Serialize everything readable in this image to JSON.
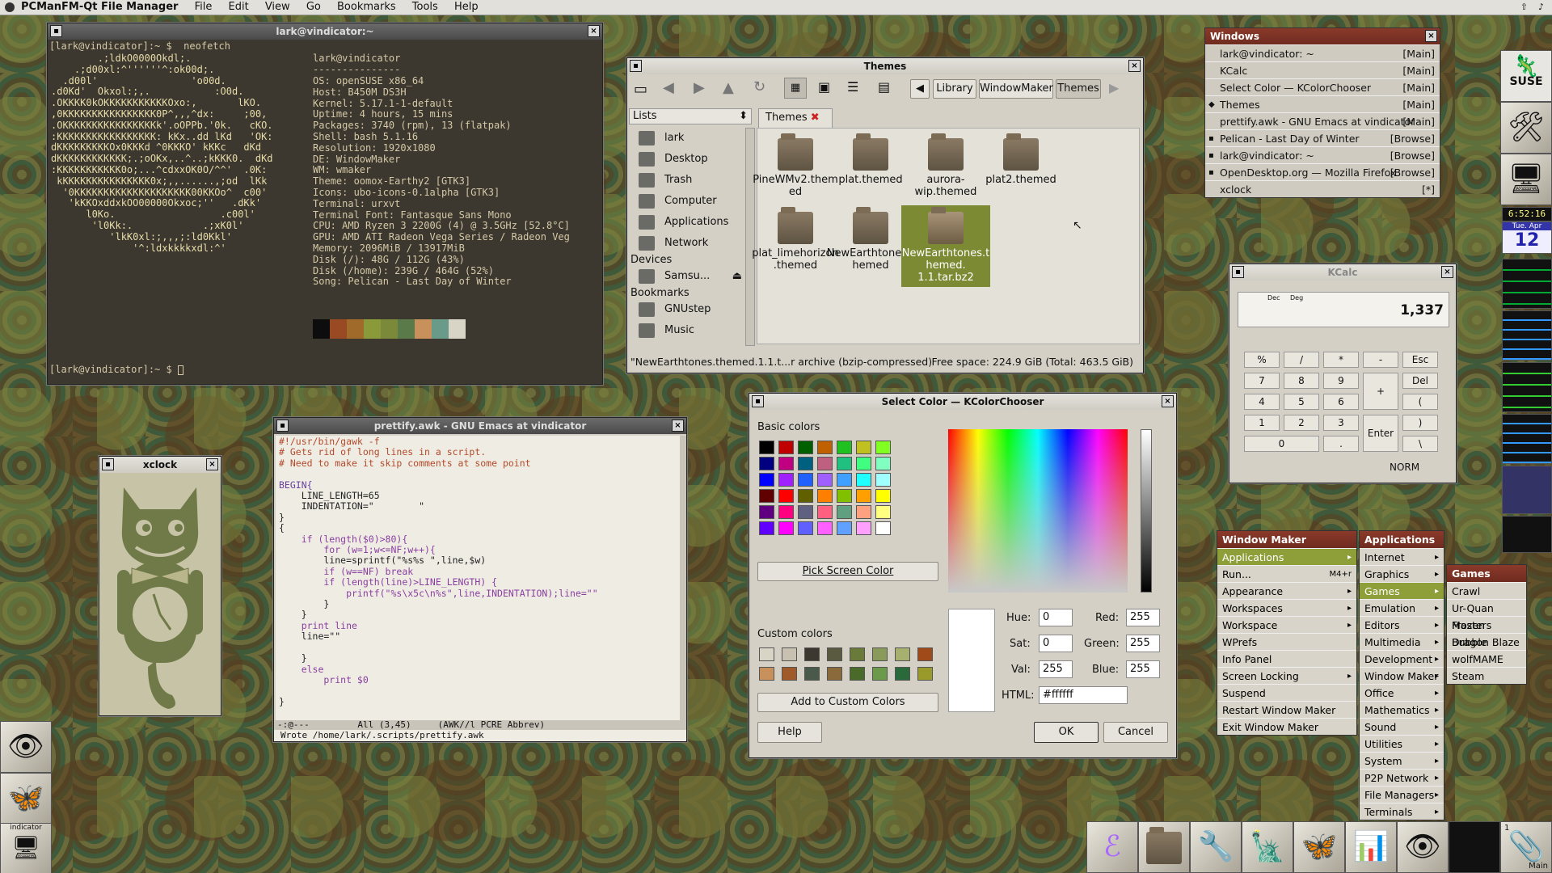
{
  "topbar": {
    "app": "PCManFM-Qt File Manager",
    "menus": [
      "File",
      "Edit",
      "View",
      "Go",
      "Bookmarks",
      "Tools",
      "Help"
    ]
  },
  "terminal": {
    "title": "lark@vindicator:~",
    "prompt": "[lark@vindicator]:~ $  neofetch",
    "logo": [
      "        .;ldkO0000Okdl;.",
      "    .;d00xl:^''''''^:ok00d;.",
      "  .d00l'                'o00d.",
      ".d0Kd'  Okxol:;,.           :O0d.",
      ".OKKKK0kOKKKKKKKKKKKOxo:,       lKO.",
      ",0KKKKKKKKKKKKKKKK0P^,,,^dx:     ;00,",
      ".OKKKKKKKKKKKKKKKKk'.oOPPb.'0k.   cKO.",
      ":KKKKKKKKKKKKKKKKK: kKx..dd lKd   'OK:",
      "dKKKKKKKKKOx0KKKd ^0KKKO' kKKc   dKd",
      "dKKKKKKKKKKKK;.;oOKx,..^..;kKKK0.  dKd",
      ":KKKKKKKKKKK0o;...^cdxxOK0O/^^'  .0K:",
      " kKKKKKKKKKKKKKKK0x;,,......,;od  lKk",
      "  '0KKKKKKKKKKKKKKKKKKKK00KKOo^  c00'",
      "   'kKKOxddxkOO00000Okxoc;''   .dKk'",
      "      l0Ko.                  .c00l'",
      "       'l0Kk:.            .;xK0l'",
      "          'lkK0xl:;,,,;:ld0Kkl'",
      "              '^:ldxkkkkxdl:^'"
    ],
    "user": "lark@vindicator",
    "sep": "---------------",
    "info": [
      "OS: openSUSE x86_64",
      "Host: B450M DS3H",
      "Kernel: 5.17.1-1-default",
      "Uptime: 4 hours, 15 mins",
      "Packages: 3740 (rpm), 13 (flatpak)",
      "Shell: bash 5.1.16",
      "Resolution: 1920x1080",
      "DE: WindowMaker",
      "WM: wmaker",
      "Theme: oomox-Earthy2 [GTK3]",
      "Icons: ubo-icons-0.1alpha [GTK3]",
      "Terminal: urxvt",
      "Terminal Font: Fantasque Sans Mono",
      "CPU: AMD Ryzen 3 2200G (4) @ 3.5GHz [52.8°C]",
      "GPU: AMD ATI Radeon Vega Series / Radeon Veg",
      "Memory: 2096MiB / 13917MiB",
      "Disk (/): 48G / 112G (43%)",
      "Disk (/home): 239G / 464G (52%)",
      "Song: Pelican - Last Day of Winter"
    ],
    "palette": [
      "#0d0d0d",
      "#9a4a22",
      "#a06a2a",
      "#8a9a3a",
      "#7a8a3a",
      "#5a7a4a",
      "#c8905a",
      "#6a9a8a",
      "#d8d4c6"
    ],
    "prompt2": "[lark@vindicator]:~ $ "
  },
  "themes": {
    "title": "Themes",
    "path": [
      "Library",
      "WindowMaker",
      "Themes"
    ],
    "panel_select": "Lists",
    "places": [
      "lark",
      "Desktop",
      "Trash",
      "Computer",
      "Applications",
      "Network"
    ],
    "devices_label": "Devices",
    "devices": [
      "Samsu..."
    ],
    "bookmarks_label": "Bookmarks",
    "bookmarks": [
      "GNUstep",
      "Music"
    ],
    "tab": "Themes",
    "files": [
      "PineWMv2.themed",
      "plat.themed",
      "aurora-wip.themed",
      "plat2.themed",
      "plat_limehorizon.themed",
      "NewEarthtones.themed",
      "NewEarthtones.themed.1.1.tar.bz2"
    ],
    "files_display": [
      "PineWMv2.them\ned",
      "plat.themed",
      "aurora-\nwip.themed",
      "plat2.themed",
      "plat_limehorizon\n.themed",
      "NewEarthtones.t\nhemed",
      "NewEarthtones.t\nhemed.\n1.1.tar.bz2"
    ],
    "status_left": "\"NewEarthtones.themed.1.1.t...r archive (bzip-compressed)",
    "status_right": "Free space: 224.9 GiB (Total: 463.5 GiB)"
  },
  "windows_list": {
    "title": "Windows",
    "rows": [
      {
        "name": "lark@vindicator: ~",
        "tag": "[Main]",
        "mark": ""
      },
      {
        "name": "KCalc",
        "tag": "[Main]",
        "mark": ""
      },
      {
        "name": "Select Color — KColorChooser",
        "tag": "[Main]",
        "mark": ""
      },
      {
        "name": "Themes",
        "tag": "[Main]",
        "mark": "◆"
      },
      {
        "name": "prettify.awk - GNU Emacs at vindicator",
        "tag": "[Main]",
        "mark": ""
      },
      {
        "name": "Pelican - Last Day of Winter",
        "tag": "[Browse]",
        "mark": "▪"
      },
      {
        "name": "lark@vindicator: ~",
        "tag": "[Browse]",
        "mark": "▪"
      },
      {
        "name": "OpenDesktop.org — Mozilla Firefox",
        "tag": "[Browse]",
        "mark": "▪"
      },
      {
        "name": "xclock",
        "tag": "[*]",
        "mark": ""
      }
    ]
  },
  "kcalc": {
    "title": "KCalc",
    "mode1": "Dec",
    "mode2": "Deg",
    "display": "1,337",
    "keys": [
      "%",
      "/",
      "*",
      "-",
      "Esc",
      "7",
      "8",
      "9",
      "+",
      "Del",
      "4",
      "5",
      "6",
      "(",
      "1",
      "2",
      "3",
      "Enter",
      ")",
      "0",
      ".",
      "\\"
    ],
    "status": "NORM"
  },
  "emacs": {
    "title": "prettify.awk - GNU Emacs at vindicator",
    "lines": [
      "#!/usr/bin/gawk -f",
      "# Gets rid of long lines in a script.",
      "# Need to make it skip comments at some point",
      "",
      "BEGIN{",
      "    LINE_LENGTH=65",
      "    INDENTATION=\"        \"",
      "}",
      "{",
      "    if (length($0)>80){",
      "        for (w=1;w<=NF;w++){",
      "        line=sprintf(\"%s%s \",line,$w)",
      "        if (w==NF) break",
      "        if (length(line)>LINE_LENGTH) {",
      "            printf(\"%s\\x5c\\n%s\",line,INDENTATION);line=\"\"",
      "        }",
      "    }",
      "    print line",
      "    line=\"\"",
      "",
      "    }",
      "    else",
      "        print $0",
      "",
      "}"
    ],
    "modeline": "-:@---         All (3,45)     (AWK//l PCRE Abbrev)",
    "echo": "Wrote /home/lark/.scripts/prettify.awk"
  },
  "xclock": {
    "title": "xclock"
  },
  "colorchooser": {
    "title": "Select Color — KColorChooser",
    "basic_label": "Basic colors",
    "basic": [
      "#000000",
      "#c00000",
      "#006000",
      "#c06000",
      "#20c020",
      "#c0c020",
      "#80ff20",
      "#000080",
      "#c00080",
      "#006080",
      "#c06080",
      "#20c080",
      "#40ff80",
      "#80ffc0",
      "#0000ff",
      "#a020ff",
      "#2060ff",
      "#a060ff",
      "#40a0ff",
      "#20ffff",
      "#a0ffff",
      "#600000",
      "#ff0000",
      "#606000",
      "#ff8000",
      "#80c000",
      "#ffa000",
      "#ffff00",
      "#600080",
      "#ff0080",
      "#606080",
      "#ff6080",
      "#60a080",
      "#ffa080",
      "#ffff80",
      "#6000ff",
      "#ff00ff",
      "#6060ff",
      "#ff60ff",
      "#60a0ff",
      "#ffa0ff",
      "#ffffff"
    ],
    "pick_label": "Pick Screen Color",
    "custom_label": "Custom colors",
    "custom": [
      "#d8d4c6",
      "#c8c0b0",
      "#3c382f",
      "#5a5a40",
      "#6a7a3a",
      "#8a9a5a",
      "#a8b070",
      "#a04a1a",
      "#c8905a",
      "#a05a2a",
      "#4a5a4a",
      "#8a6a3a",
      "#4a6a2a",
      "#6a9a4a",
      "#2a6a3a",
      "#9a9a2a"
    ],
    "add_label": "Add to Custom Colors",
    "hue_label": "Hue:",
    "hue": "0",
    "sat_label": "Sat:",
    "sat": "0",
    "val_label": "Val:",
    "val": "255",
    "red_label": "Red:",
    "red": "255",
    "green_label": "Green:",
    "green": "255",
    "blue_label": "Blue:",
    "blue": "255",
    "html_label": "HTML:",
    "html": "#ffffff",
    "help": "Help",
    "ok": "OK",
    "cancel": "Cancel"
  },
  "wm_menu": {
    "title": "Window Maker",
    "items": [
      [
        "Applications",
        "▸"
      ],
      [
        "Run...",
        "M4+r"
      ],
      [
        "Appearance",
        "▸"
      ],
      [
        "Workspaces",
        "▸"
      ],
      [
        "Workspace",
        "▸"
      ],
      [
        "WPrefs",
        ""
      ],
      [
        "Info Panel",
        ""
      ],
      [
        "Screen Locking",
        "▸"
      ],
      [
        "Suspend",
        ""
      ],
      [
        "Restart Window Maker",
        ""
      ],
      [
        "Exit Window Maker",
        ""
      ]
    ]
  },
  "apps_menu": {
    "title": "Applications",
    "items": [
      "Internet",
      "Graphics",
      "Games",
      "Emulation",
      "Editors",
      "Multimedia",
      "Development",
      "Window Maker",
      "Office",
      "Mathematics",
      "Sound",
      "Utilities",
      "System",
      "P2P Network",
      "File Managers",
      "Terminals"
    ]
  },
  "games_menu": {
    "title": "Games",
    "items": [
      "Crawl",
      "Ur-Quan Masters",
      "Frozen Bubble",
      "Dragon Blaze",
      "wolfMAME",
      "Steam"
    ]
  },
  "dockapps": {
    "suse": "SUSE",
    "time": "6:52:16",
    "date_top": "Tue. Apr",
    "date_num": "12",
    "workspace_label": "indicator",
    "clip_label": "Main",
    "clip_num": "1"
  }
}
